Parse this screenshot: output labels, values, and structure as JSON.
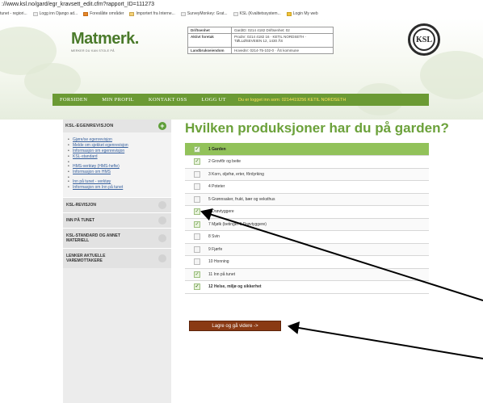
{
  "browser": {
    "url": "://www.ksl.no/gard/egr_kravsett_edit.cfm?rapport_ID=111273",
    "bookmarks": [
      "tunet - regiori...",
      "Logg inn Django ad...",
      "Foreslåtte områder",
      "Importert fra Interne...",
      "SurveyMonkey: Grat...",
      "KSL (Kvalitetssystem...",
      "Login My web"
    ]
  },
  "header": {
    "logo": "Matmerk.",
    "logo_tagline": "MERKER DU KAN STOLE PÅ",
    "info": [
      {
        "key": "Driftsenhet",
        "value": "GardID: 0214 4182 Driftsenhet: 02"
      },
      {
        "key": "Aktivt foretak",
        "value": "Prodnr: 0214 4182 16 · KETIL NORDSETH · TØLLØSEVEIEN 12, 1430 ÅS"
      },
      {
        "key": "Landbrukseiendom",
        "value": "Hovednr: 0214-75-102-0 · ÅS kommune"
      }
    ],
    "badge": "KSL",
    "nav": [
      "FORSIDEN",
      "MIN PROFIL",
      "KONTAKT OSS",
      "LOGG UT"
    ],
    "status": "Du er logget inn som: 0214419256 KETIL NORDSETH"
  },
  "sidebar": {
    "active_title": "KSL-EGENREVISJON",
    "links": [
      "Gjøre/se egenrevisjon",
      "Melde om sjekket egenrevisjon",
      "Informasjon om egenrevisjon",
      "KSL-standard",
      "HMS-verktøy (HMS-hefte)",
      "Informasjon om HMS",
      "Inn på tunet - verktøy",
      "Informasjon om Inn på tunet"
    ],
    "sections": [
      "KSL-REVISJON",
      "INN PÅ TUNET",
      "KSL-STANDARD OG ANNET MATERIELL",
      "LENKER AKTUELLE VAREMOTTAKERE"
    ]
  },
  "main": {
    "title": "Hvilken produksjoner har du på garden?",
    "rows": [
      {
        "label": "1 Garden",
        "checked": true
      },
      {
        "label": "2 Grovfôr og beite",
        "checked": true
      },
      {
        "label": "3 Korn, oljefrø, erter, fôrdyrking",
        "checked": false
      },
      {
        "label": "4 Poteter",
        "checked": false
      },
      {
        "label": "5 Grønnsaker, frukt, bær og veksthus",
        "checked": false
      },
      {
        "label": "6 Drøvtyggere",
        "checked": true
      },
      {
        "label": "7 Mjølk (betinger 6 Drøvtyggere)",
        "checked": true
      },
      {
        "label": "8 Svin",
        "checked": false
      },
      {
        "label": "9 Fjørfe",
        "checked": false
      },
      {
        "label": "10 Honning",
        "checked": false
      },
      {
        "label": "11 Inn på tunet",
        "checked": true
      },
      {
        "label": "12 Helse, miljø og sikkerhet",
        "checked": true
      }
    ],
    "submit_label": "Lagre og gå videre ->"
  },
  "colors": {
    "nav": "#6b9a34",
    "title": "#6ba13a",
    "table_header": "#92c25a",
    "submit": "#8a3a14"
  }
}
